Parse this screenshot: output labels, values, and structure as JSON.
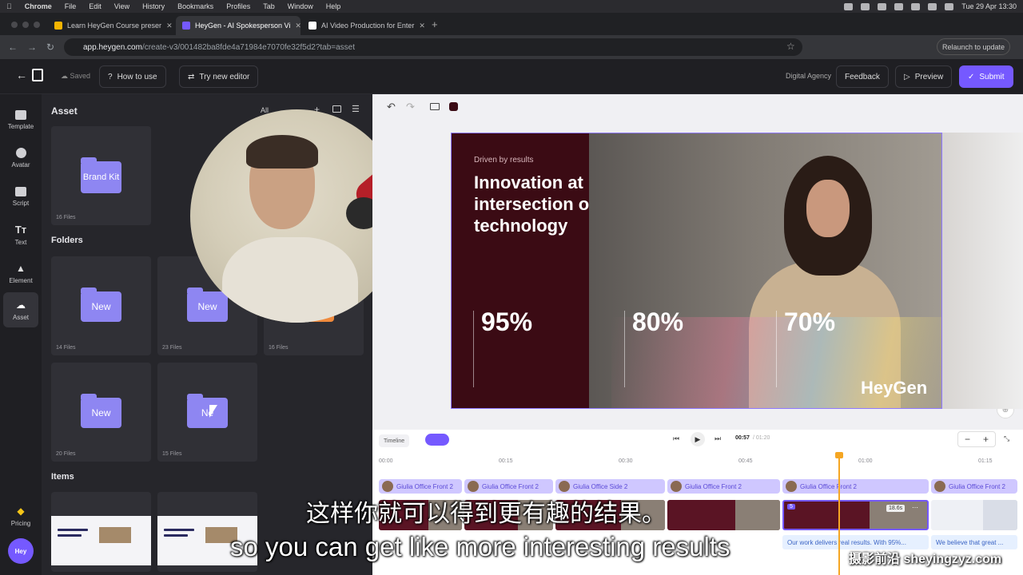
{
  "os_menubar": {
    "items": [
      "Chrome",
      "File",
      "Edit",
      "View",
      "History",
      "Bookmarks",
      "Profiles",
      "Tab",
      "Window",
      "Help"
    ],
    "datetime": "Tue 29 Apr  13:30"
  },
  "browser": {
    "tabs": [
      {
        "label": "Learn HeyGen Course preser",
        "active": false,
        "favicon_color": "#f4b400"
      },
      {
        "label": "HeyGen - AI Spokesperson Vi",
        "active": true,
        "favicon_color": "#7559ff"
      },
      {
        "label": "AI Video Production for Enter",
        "active": false,
        "favicon_color": "#ffffff"
      }
    ],
    "url_domain": "app.heygen.com",
    "url_path": "/create-v3/001482ba8fde4a71984e7070fe32f5d2?tab=asset",
    "relaunch_label": "Relaunch to update"
  },
  "header": {
    "saved_label": "Saved",
    "how_to_use": "How to use",
    "try_new_editor": "Try new editor",
    "workspace": "Digital Agency",
    "feedback": "Feedback",
    "preview": "Preview",
    "submit": "Submit"
  },
  "rail": [
    {
      "label": "Template",
      "icon": "template-icon"
    },
    {
      "label": "Avatar",
      "icon": "avatar-icon"
    },
    {
      "label": "Script",
      "icon": "script-icon"
    },
    {
      "label": "Text",
      "icon": "text-icon"
    },
    {
      "label": "Element",
      "icon": "element-icon"
    },
    {
      "label": "Asset",
      "icon": "asset-icon",
      "active": true
    },
    {
      "label": "Pricing",
      "icon": "diamond-icon"
    }
  ],
  "user_avatar": "Hey",
  "asset_panel": {
    "title": "Asset",
    "filter": "All",
    "brand_kit": {
      "label": "Brand Kit",
      "files": "16 Files"
    },
    "folders_title": "Folders",
    "folders": [
      {
        "label": "New",
        "files": "14 Files"
      },
      {
        "label": "New",
        "files": "23 Files"
      },
      {
        "label": "",
        "files": "16 Files"
      },
      {
        "label": "New",
        "files": "20 Files"
      },
      {
        "label": "Ne",
        "files": "15 Files"
      }
    ],
    "items_title": "Items"
  },
  "slide": {
    "kicker": "Driven by results",
    "headline": "Innovation at\nintersection o\ntechnology",
    "stats": [
      "95%",
      "80%",
      "70%"
    ],
    "logo": "HeyGen"
  },
  "timeline": {
    "label": "Timeline",
    "current_time": "00:57",
    "total_time": "/ 01:20",
    "ticks": [
      "00:00",
      "00:15",
      "00:30",
      "00:45",
      "01:00",
      "01:15"
    ],
    "avatar_clips": [
      "Giulia Office Front 2",
      "Giulia Office Front 2",
      "Giulia Office Side 2",
      "Giulia Office Front 2",
      "Giulia Office Front 2",
      "Giulia Office Front 2"
    ],
    "selected_duration": "18.6s",
    "selected_index": "5",
    "text_clips": [
      "Our work delivers real results. With 95%...",
      "We believe that great ..."
    ]
  },
  "subtitles": {
    "chinese": "这样你就可以得到更有趣的结果。",
    "english": "so you can get like more interesting results"
  },
  "watermark": "摄影前沿 sheyingzyz.com",
  "colors": {
    "accent": "#7559ff",
    "slide_bg": "#3b0b14",
    "playhead": "#f5a623",
    "folder": "#8e86f2"
  }
}
